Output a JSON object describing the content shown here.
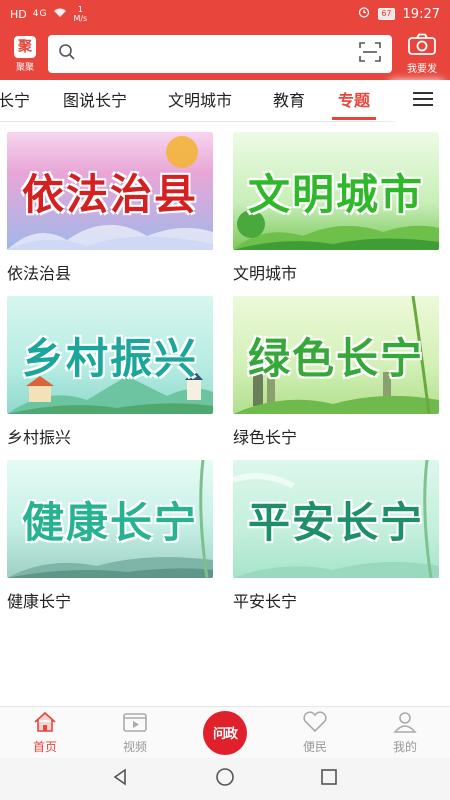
{
  "status_bar": {
    "network": "HD",
    "signal": "4G",
    "speed": "1\nM/s",
    "battery": "67",
    "time": "19:27"
  },
  "header": {
    "logo_char": "聚",
    "logo_label": "聚聚",
    "search_placeholder": "",
    "camera_label": "我要发"
  },
  "tabs": [
    {
      "label": "长宁",
      "active": false
    },
    {
      "label": "图说长宁",
      "active": false
    },
    {
      "label": "文明城市",
      "active": false
    },
    {
      "label": "教育",
      "active": false
    },
    {
      "label": "专题",
      "active": true
    }
  ],
  "cards": [
    {
      "image_text": "依法治县",
      "title": "依法治县",
      "theme": "red"
    },
    {
      "image_text": "文明城市",
      "title": "文明城市",
      "theme": "green1"
    },
    {
      "image_text": "乡村振兴",
      "title": "乡村振兴",
      "theme": "teal"
    },
    {
      "image_text": "绿色长宁",
      "title": "绿色长宁",
      "theme": "green2"
    },
    {
      "image_text": "健康长宁",
      "title": "健康长宁",
      "theme": "cyan"
    },
    {
      "image_text": "平安长宁",
      "title": "平安长宁",
      "theme": "mint"
    }
  ],
  "bottom_nav": [
    {
      "label": "首页",
      "icon": "home-icon",
      "active": true
    },
    {
      "label": "视频",
      "icon": "video-icon",
      "active": false
    },
    {
      "label": "问政",
      "icon": "center-icon",
      "active": false
    },
    {
      "label": "便民",
      "icon": "heart-icon",
      "active": false
    },
    {
      "label": "我的",
      "icon": "user-icon",
      "active": false
    }
  ],
  "colors": {
    "brand_red": "#e8453c",
    "inactive_gray": "#999999"
  }
}
